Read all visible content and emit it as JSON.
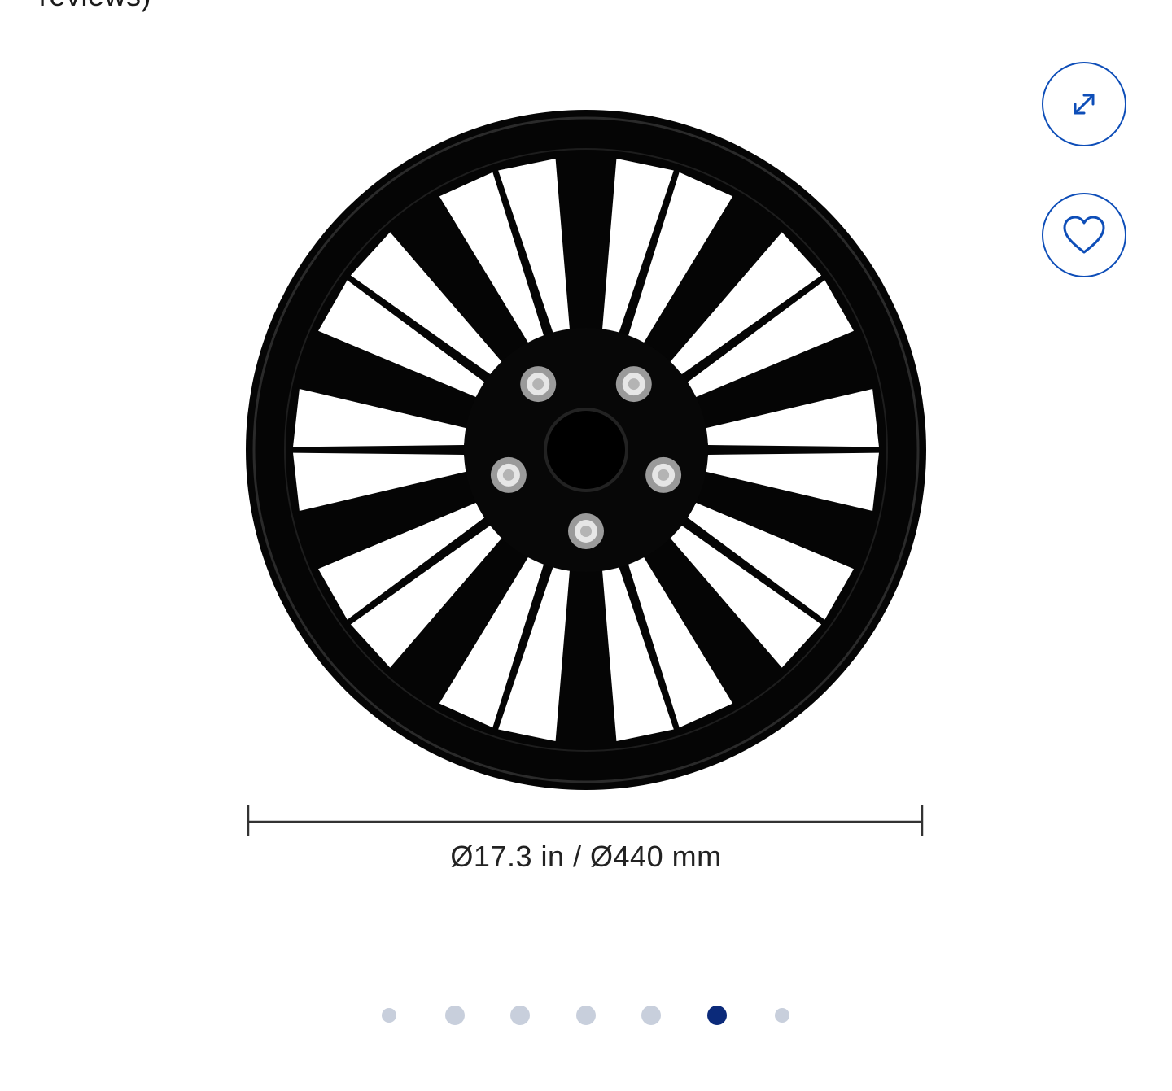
{
  "header": {
    "reviews_cutoff_text": "reviews)"
  },
  "product_image": {
    "subject": "black wheel cover hubcap",
    "dimension_label": "Ø17.3  in / Ø440  mm"
  },
  "actions": {
    "expand_icon": "expand-arrows-icon",
    "favorite_icon": "heart-icon"
  },
  "carousel": {
    "dot_count": 7,
    "active_index": 5
  },
  "colors": {
    "accent": "#0e4eb8",
    "dot_active": "#0b2a7a",
    "dot_inactive": "#c8cfdc"
  }
}
